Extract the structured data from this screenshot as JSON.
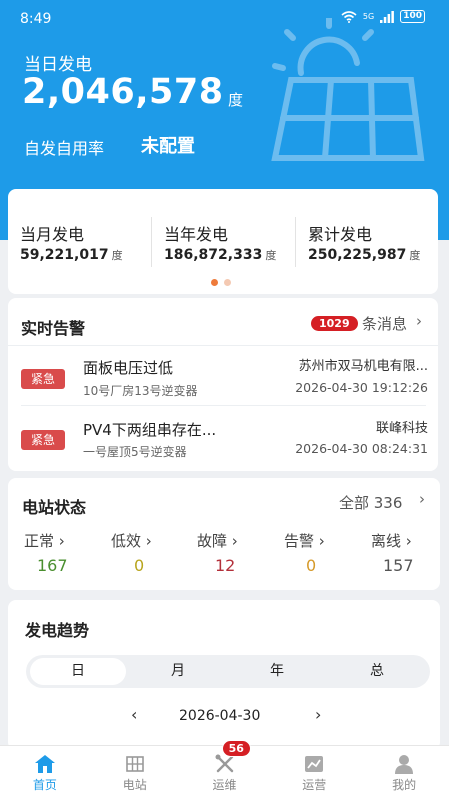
{
  "status_bar": {
    "time": "8:49",
    "signal": "5G",
    "battery": "100"
  },
  "hero": {
    "today_label": "当日发电",
    "today_value": "2,046,578",
    "today_unit": "度",
    "selfuse_label": "自发自用率",
    "selfuse_value": "未配置"
  },
  "stats": [
    {
      "title": "当月发电",
      "value": "59,221,017",
      "unit": "度"
    },
    {
      "title": "当年发电",
      "value": "186,872,333",
      "unit": "度"
    },
    {
      "title": "累计发电",
      "value": "250,225,987",
      "unit": "度"
    }
  ],
  "alarms": {
    "title": "实时告警",
    "count": "1029",
    "more_label": "条消息",
    "items": [
      {
        "level": "紧急",
        "title": "面板电压过低",
        "device": "10号厂房13号逆变器",
        "company": "苏州市双马机电有限...",
        "time": "2026-04-30 19:12:26"
      },
      {
        "level": "紧急",
        "title": "PV4下两组串存在...",
        "device": "一号屋顶5号逆变器",
        "company": "联峰科技",
        "time": "2026-04-30 08:24:31"
      }
    ]
  },
  "station_status": {
    "title": "电站状态",
    "total_label": "全部 336",
    "items": [
      {
        "label": "正常",
        "value": "167",
        "color": "#4a8f2f"
      },
      {
        "label": "低效",
        "value": "0",
        "color": "#b8a51e"
      },
      {
        "label": "故障",
        "value": "12",
        "color": "#b3303a"
      },
      {
        "label": "告警",
        "value": "0",
        "color": "#d69a2a"
      },
      {
        "label": "离线",
        "value": "157",
        "color": "#555555"
      }
    ]
  },
  "trend": {
    "title": "发电趋势",
    "tabs": [
      "日",
      "月",
      "年",
      "总"
    ],
    "date": "2026-04-30"
  },
  "tabbar": {
    "items": [
      {
        "label": "首页",
        "icon": "home-icon"
      },
      {
        "label": "电站",
        "icon": "station-icon"
      },
      {
        "label": "运维",
        "icon": "tools-icon",
        "badge": "56"
      },
      {
        "label": "运营",
        "icon": "chart-icon"
      },
      {
        "label": "我的",
        "icon": "user-icon"
      }
    ]
  },
  "colors": {
    "accent": "#1e9be8",
    "urgent": "#d94b4b",
    "badge": "#d51f24"
  }
}
